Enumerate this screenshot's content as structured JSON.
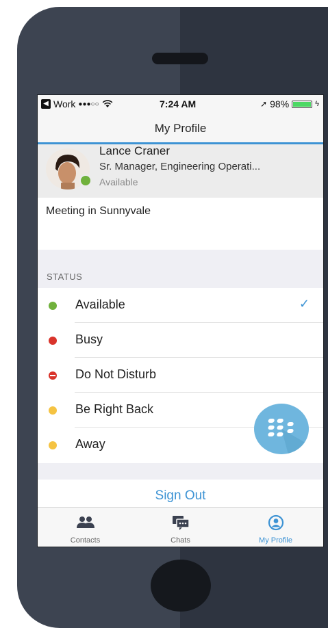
{
  "status_bar": {
    "carrier": "Work",
    "signal": "●●●○○",
    "time": "7:24 AM",
    "battery_percent": "98%",
    "battery_level": 0.98
  },
  "nav": {
    "title": "My Profile"
  },
  "profile": {
    "name": "Lance Craner",
    "job_title": "Sr. Manager, Engineering Operati...",
    "presence": "Available",
    "presence_color": "#70b13c"
  },
  "note": {
    "text": "Meeting in Sunnyvale"
  },
  "status_section": {
    "header": "STATUS",
    "items": [
      {
        "label": "Available",
        "color": "#70b13c",
        "selected": true
      },
      {
        "label": "Busy",
        "color": "#d9342b",
        "selected": false
      },
      {
        "label": "Do Not Disturb",
        "color": "#d9342b",
        "selected": false
      },
      {
        "label": "Be Right Back",
        "color": "#f5c342",
        "selected": false
      },
      {
        "label": "Away",
        "color": "#f5c342",
        "selected": false
      }
    ],
    "check_glyph": "✓"
  },
  "actions": {
    "sign_out": "Sign Out"
  },
  "tabs": [
    {
      "label": "Contacts",
      "icon": "contacts-icon",
      "active": false
    },
    {
      "label": "Chats",
      "icon": "chats-icon",
      "active": false
    },
    {
      "label": "My Profile",
      "icon": "profile-icon",
      "active": true
    }
  ],
  "colors": {
    "accent": "#3d93d4",
    "fab": "#6fb6de"
  }
}
